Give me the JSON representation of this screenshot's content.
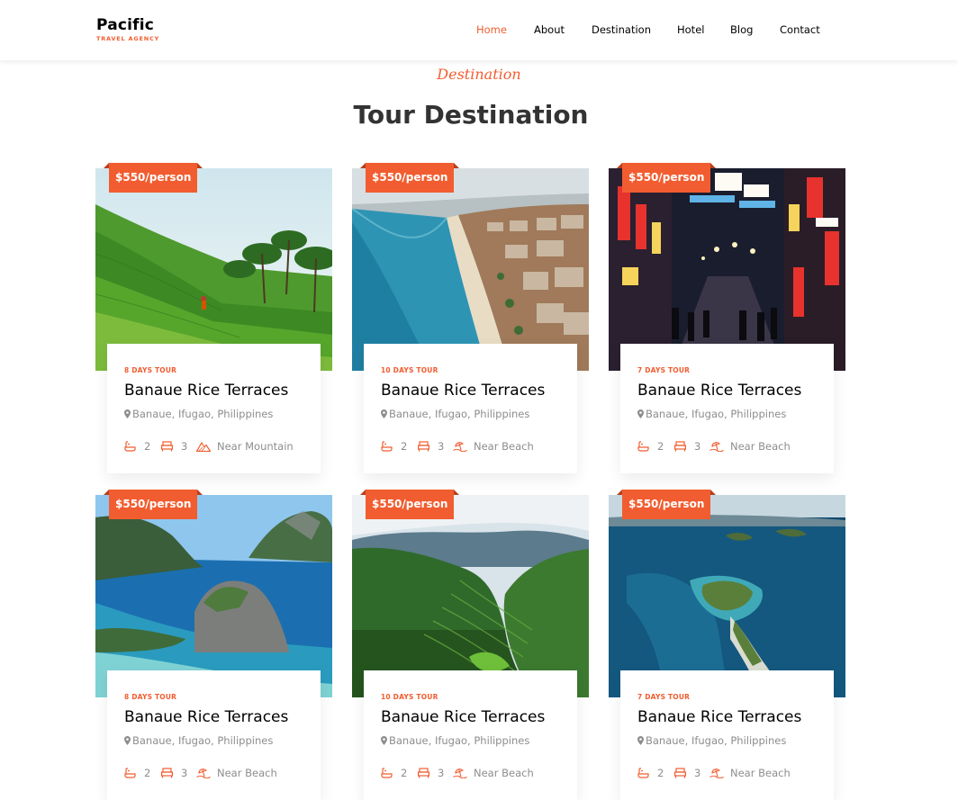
{
  "brand": {
    "name": "Pacific",
    "tagline": "TRAVEL AGENCY"
  },
  "nav": {
    "items": [
      {
        "label": "Home",
        "active": true
      },
      {
        "label": "About"
      },
      {
        "label": "Destination"
      },
      {
        "label": "Hotel"
      },
      {
        "label": "Blog"
      },
      {
        "label": "Contact"
      }
    ]
  },
  "section": {
    "subheading": "Destination",
    "heading": "Tour Destination"
  },
  "colors": {
    "accent": "#f15d30",
    "text": "#000000",
    "muted": "#8d8d8d",
    "heading": "#333333"
  },
  "cards": [
    {
      "price": "$550/person",
      "days": "8 DAYS TOUR",
      "title": "Banaue Rice Terraces",
      "location": "Banaue, Ifugao, Philippines",
      "baths": "2",
      "beds": "3",
      "feature": "Near Mountain",
      "feature_icon": "mountain-icon",
      "scene": "rice-terraces-with-palms"
    },
    {
      "price": "$550/person",
      "days": "10 DAYS TOUR",
      "title": "Banaue Rice Terraces",
      "location": "Banaue, Ifugao, Philippines",
      "baths": "2",
      "beds": "3",
      "feature": "Near Beach",
      "feature_icon": "beach-icon",
      "scene": "coastline-beach-city"
    },
    {
      "price": "$550/person",
      "days": "7 DAYS TOUR",
      "title": "Banaue Rice Terraces",
      "location": "Banaue, Ifugao, Philippines",
      "baths": "2",
      "beds": "3",
      "feature": "Near Beach",
      "feature_icon": "beach-icon",
      "scene": "night-city-street"
    },
    {
      "price": "$550/person",
      "days": "8 DAYS TOUR",
      "title": "Banaue Rice Terraces",
      "location": "Banaue, Ifugao, Philippines",
      "baths": "2",
      "beds": "3",
      "feature": "Near Beach",
      "feature_icon": "beach-icon",
      "scene": "limestone-islands-lagoon"
    },
    {
      "price": "$550/person",
      "days": "10 DAYS TOUR",
      "title": "Banaue Rice Terraces",
      "location": "Banaue, Ifugao, Philippines",
      "baths": "2",
      "beds": "3",
      "feature": "Near Beach",
      "feature_icon": "beach-icon",
      "scene": "green-valley-terraces"
    },
    {
      "price": "$550/person",
      "days": "7 DAYS TOUR",
      "title": "Banaue Rice Terraces",
      "location": "Banaue, Ifugao, Philippines",
      "baths": "2",
      "beds": "3",
      "feature": "Near Beach",
      "feature_icon": "beach-icon",
      "scene": "aerial-islands-sea"
    }
  ]
}
